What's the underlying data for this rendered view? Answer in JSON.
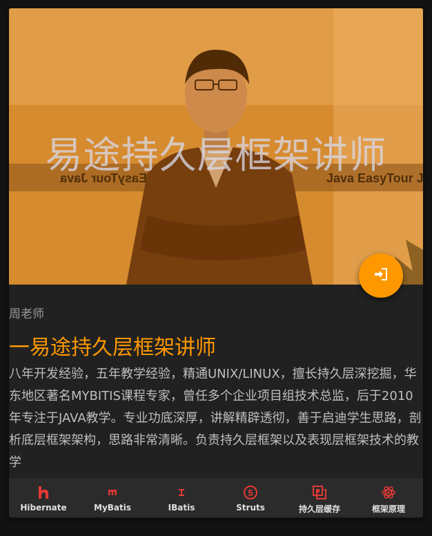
{
  "hero": {
    "overlay_text": "易途持久层框架讲师",
    "glass_text_left": "EasyTour  Java",
    "glass_text_right": "EasyTour  J"
  },
  "card": {
    "teacher": "周老师",
    "title": "一易途持久层框架讲师",
    "description": "八年开发经验，五年教学经验，精通UNIX/LINUX，擅长持久层深挖掘，华东地区著名MYBITIS课程专家，曾任多个企业项目组技术总监，后于2010年专注于JAVA教学。专业功底深厚，讲解精辟透彻，善于启迪学生思路，剖析底层框架架构，思路非常清晰。负责持久层框架以及表现层框架技术的教学"
  },
  "fab": {
    "icon": "login-icon",
    "color": "#ff9800"
  },
  "bottom_nav": [
    {
      "label": "Hibernate",
      "icon": "hibernate-icon",
      "color": "#e53935"
    },
    {
      "label": "MyBatis",
      "icon": "mybatis-icon",
      "color": "#e53935"
    },
    {
      "label": "IBatis",
      "icon": "ibatis-icon",
      "color": "#e53935"
    },
    {
      "label": "Struts",
      "icon": "struts-icon",
      "color": "#e53935"
    },
    {
      "label": "持久层缓存",
      "icon": "cache-icon",
      "color": "#e53935"
    },
    {
      "label": "框架原理",
      "icon": "framework-icon",
      "color": "#e53935"
    }
  ],
  "colors": {
    "accent": "#ff9800",
    "background": "#121212",
    "card": "#212121"
  }
}
